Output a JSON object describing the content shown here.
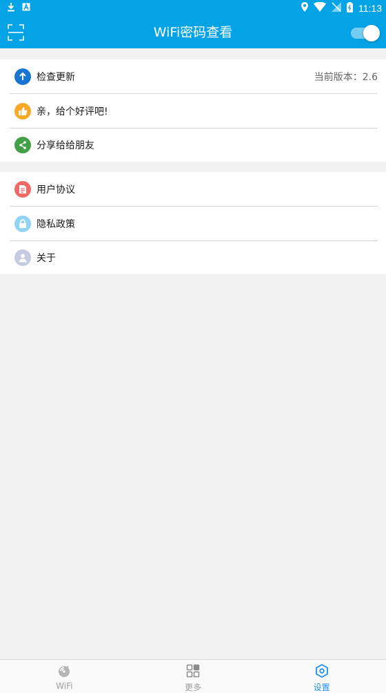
{
  "status_bar": {
    "time": "11:13",
    "icons": [
      "download-icon",
      "a-box-icon",
      "location-icon",
      "wifi-signal-icon",
      "no-sim-icon",
      "battery-icon"
    ]
  },
  "app_bar": {
    "title": "WiFi密码查看",
    "left_icon": "scan-icon",
    "toggle_on": true
  },
  "settings": {
    "group1": [
      {
        "label": "检查更新",
        "value": "当前版本：2.6",
        "icon": "arrow-up-icon",
        "color": "#1876d2"
      },
      {
        "label": "亲，给个好评吧!",
        "icon": "thumbs-up-icon",
        "color": "#f9a825"
      },
      {
        "label": "分享给给朋友",
        "icon": "share-icon",
        "color": "#43a047"
      }
    ],
    "group2": [
      {
        "label": "用户协议",
        "icon": "document-icon",
        "color": "#ef6a67"
      },
      {
        "label": "隐私政策",
        "icon": "lock-icon",
        "color": "#91d3f2"
      },
      {
        "label": "关于",
        "icon": "person-icon",
        "color": "#c5cbe0"
      }
    ]
  },
  "bottom_nav": {
    "items": [
      {
        "label": "WiFi",
        "icon": "wifi-radar-icon",
        "active": false
      },
      {
        "label": "更多",
        "icon": "grid-icon",
        "active": false
      },
      {
        "label": "设置",
        "icon": "settings-hex-icon",
        "active": true
      }
    ],
    "active_color": "#1e8ff0",
    "inactive_color": "#9e9e9e"
  }
}
